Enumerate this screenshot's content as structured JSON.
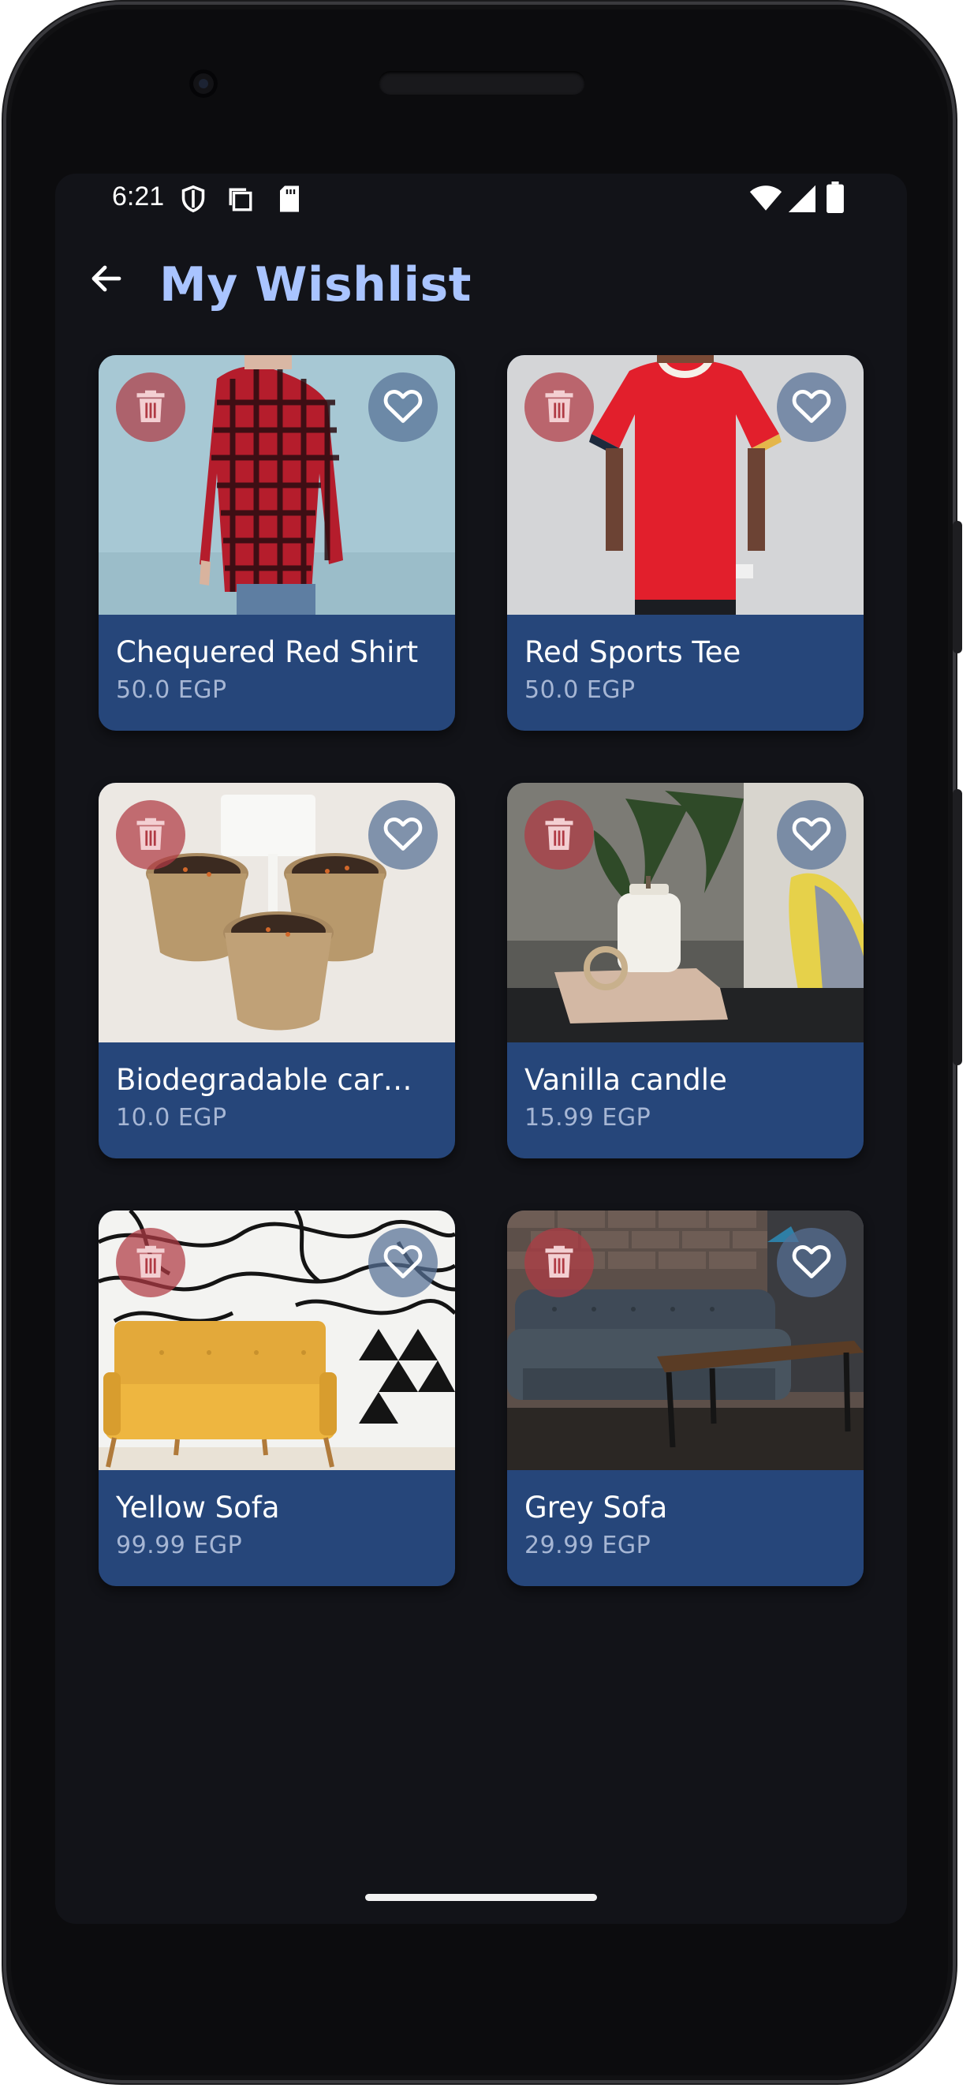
{
  "status_bar": {
    "time": "6:21",
    "icons_left": [
      "shield-icon",
      "copy-icon",
      "sd-card-icon"
    ],
    "icons_right": [
      "wifi-icon",
      "signal-icon",
      "battery-icon"
    ]
  },
  "app_bar": {
    "back_icon": "arrow-left-icon",
    "title": "My Wishlist"
  },
  "colors": {
    "background": "#121318",
    "title": "#a9c4ff",
    "card": "#26467a",
    "delete": "#b03a44",
    "favorite": "#567096"
  },
  "wishlist": {
    "items": [
      {
        "name": "Chequered Red Shirt",
        "price": "50.0 EGP",
        "image": "red-plaid-shirt-photo"
      },
      {
        "name": "Red Sports Tee",
        "price": "50.0 EGP",
        "image": "red-tshirt-photo"
      },
      {
        "name": "Biodegradable car…",
        "price": "10.0 EGP",
        "image": "seedling-pots-photo"
      },
      {
        "name": "Vanilla candle",
        "price": "15.99 EGP",
        "image": "candle-jar-photo"
      },
      {
        "name": "Yellow Sofa",
        "price": "99.99 EGP",
        "image": "yellow-sofa-photo"
      },
      {
        "name": "Grey Sofa",
        "price": "29.99 EGP",
        "image": "grey-sofa-photo"
      }
    ]
  }
}
